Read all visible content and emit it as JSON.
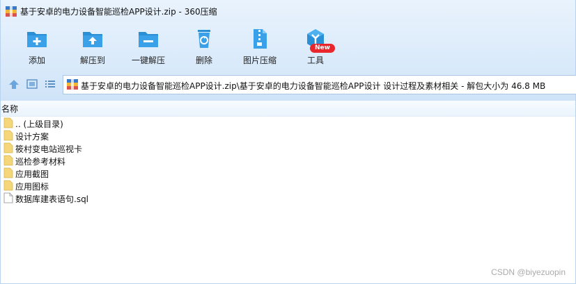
{
  "window": {
    "title": "基于安卓的电力设备智能巡检APP设计.zip - 360压缩",
    "app_icon": "archive-icon"
  },
  "toolbar": {
    "items": [
      {
        "label": "添加",
        "icon": "add-icon"
      },
      {
        "label": "解压到",
        "icon": "extract-to-icon"
      },
      {
        "label": "一键解压",
        "icon": "one-click-extract-icon"
      },
      {
        "label": "删除",
        "icon": "delete-icon"
      },
      {
        "label": "图片压缩",
        "icon": "image-compress-icon"
      },
      {
        "label": "工具",
        "icon": "tools-icon"
      }
    ],
    "tools_badge": "New"
  },
  "navbar": {
    "path": "基于安卓的电力设备智能巡检APP设计.zip\\基于安卓的电力设备智能巡检APP设计 设计过程及素材相关 - 解包大小为 46.8 MB"
  },
  "list": {
    "column_name": "名称",
    "items": [
      {
        "name": ".. (上级目录)",
        "type": "folder"
      },
      {
        "name": "设计方案",
        "type": "folder"
      },
      {
        "name": "筱村变电站巡视卡",
        "type": "folder"
      },
      {
        "name": "巡检参考材料",
        "type": "folder"
      },
      {
        "name": "应用截图",
        "type": "folder"
      },
      {
        "name": "应用图标",
        "type": "folder"
      },
      {
        "name": "数据库建表语句.sql",
        "type": "file"
      }
    ]
  },
  "watermark": "CSDN @biyezuopin",
  "colors": {
    "toolbar_bg": "#dceafa",
    "icon_blue": "#2b8fd6",
    "badge_red": "#e8262b",
    "folder_yellow": "#f5d67b"
  }
}
